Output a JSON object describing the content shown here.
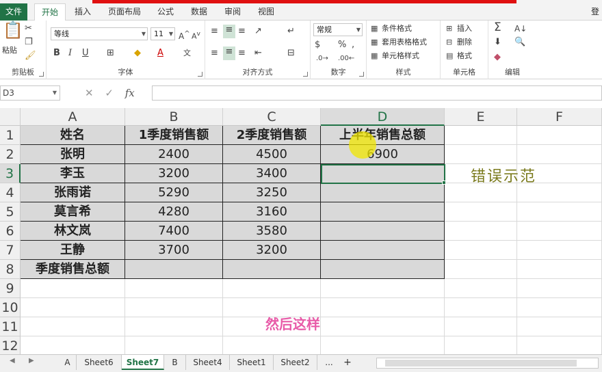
{
  "ribbon_tabs": {
    "file": "文件",
    "items": [
      "开始",
      "插入",
      "页面布局",
      "公式",
      "数据",
      "审阅",
      "视图"
    ],
    "login": "登"
  },
  "ribbon": {
    "clipboard": {
      "paste": "粘贴",
      "label": "剪贴板"
    },
    "font": {
      "name": "等线",
      "size": "11",
      "label": "字体",
      "bold": "B",
      "italic": "I",
      "underline": "U",
      "grow": "A",
      "shrink": "A",
      "color_a": "A"
    },
    "alignment": {
      "label": "对齐方式"
    },
    "number": {
      "format": "常规",
      "percent": "%",
      "comma": ",",
      "label": "数字"
    },
    "styles": {
      "conditional": "条件格式",
      "table": "套用表格格式",
      "cell": "单元格样式",
      "label": "样式"
    },
    "cells": {
      "insert": "插入",
      "delete": "删除",
      "format": "格式",
      "label": "单元格"
    },
    "editing": {
      "label": "编辑"
    }
  },
  "formula_bar": {
    "name_box": "D3",
    "fx": "fx",
    "content": ""
  },
  "grid": {
    "columns": [
      "A",
      "B",
      "C",
      "D",
      "E",
      "F"
    ],
    "rows": [
      "1",
      "2",
      "3",
      "4",
      "5",
      "6",
      "7",
      "8",
      "9",
      "10",
      "11",
      "12"
    ],
    "table": [
      [
        "姓名",
        "1季度销售额",
        "2季度销售额",
        "上半年销售总额"
      ],
      [
        "张明",
        "2400",
        "4500",
        "6900"
      ],
      [
        "李玉",
        "3200",
        "3400",
        ""
      ],
      [
        "张雨诺",
        "5290",
        "3250",
        ""
      ],
      [
        "莫言希",
        "4280",
        "3160",
        ""
      ],
      [
        "林文岚",
        "7400",
        "3580",
        ""
      ],
      [
        "王静",
        "3700",
        "3200",
        ""
      ],
      [
        "季度销售总额",
        "",
        "",
        ""
      ]
    ],
    "annotation": "错误示范",
    "subtitle": "然后这样"
  },
  "sheets": {
    "tabs": [
      "A",
      "Sheet6",
      "Sheet7",
      "B",
      "Sheet4",
      "Sheet1",
      "Sheet2",
      "..."
    ],
    "active": "Sheet7",
    "add": "+"
  },
  "colors": {
    "accent": "#217346",
    "annotation": "#7b7b1e",
    "subtitle": "#e85aa8",
    "table_fill": "#d9d9d9"
  }
}
